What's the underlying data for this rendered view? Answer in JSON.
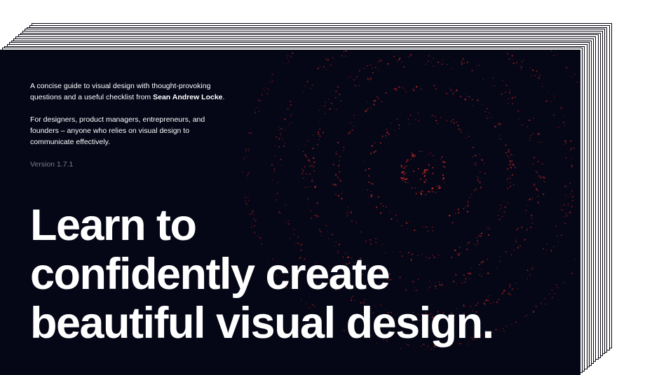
{
  "book": {
    "intro_line1": "A concise guide to visual design with thought-provoking questions and a useful checklist from",
    "author": "Sean Andrew Locke",
    "author_suffix": ".",
    "audience": "For designers, product managers, entrepreneurs, and founders – anyone who relies on visual design to communicate effectively.",
    "version": "Version 1.7.1",
    "headline": [
      "Learn to",
      "confidently create",
      "beautiful visual design."
    ]
  },
  "colors": {
    "cover_background": "#050616",
    "dot_accent": "#e0302a",
    "text": "#ffffff",
    "muted_text": "#7a7d8c"
  }
}
